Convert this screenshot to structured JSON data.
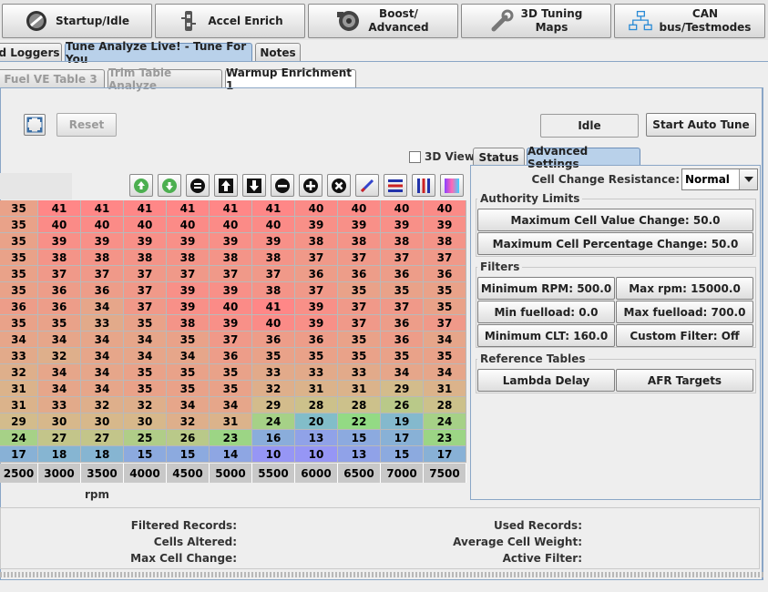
{
  "toolbar": {
    "startup": "Startup/Idle",
    "accel": "Accel Enrich",
    "boost_line1": "Boost/",
    "boost_line2": "Advanced",
    "tuning_line1": "3D Tuning",
    "tuning_line2": "Maps",
    "can_line1": "CAN",
    "can_line2": "bus/Testmodes"
  },
  "main_tabs": [
    "d Loggers",
    "Tune Analyze Live! - Tune For You",
    "Notes"
  ],
  "sub_tabs": [
    "Fuel VE Table 3",
    "Trim Table Analyze",
    "Warmup Enrichment 1"
  ],
  "controls": {
    "reset": "Reset",
    "status_value": "Idle",
    "start_auto_tune": "Start Auto Tune",
    "view_3d": "3D View"
  },
  "right_tabs": [
    "Status",
    "Advanced Settings"
  ],
  "settings": {
    "cell_change_resistance_label": "Cell Change Resistance:",
    "cell_change_resistance_value": "Normal",
    "authority_title": "Authority Limits",
    "max_cell_value_change": "Maximum Cell Value Change: 50.0",
    "max_cell_pct_change": "Maximum Cell Percentage Change: 50.0",
    "filters_title": "Filters",
    "min_rpm": "Minimum RPM: 500.0",
    "max_rpm": "Max rpm: 15000.0",
    "min_fuelload": "Min fuelload: 0.0",
    "max_fuelload": "Max fuelload: 700.0",
    "min_clt": "Minimum CLT: 160.0",
    "custom_filter": "Custom Filter: Off",
    "reference_title": "Reference Tables",
    "lambda_delay": "Lambda Delay",
    "afr_targets": "AFR Targets"
  },
  "table": {
    "x_axis": [
      "2500",
      "3000",
      "3500",
      "4000",
      "4500",
      "5000",
      "5500",
      "6000",
      "6500",
      "7000",
      "7500"
    ],
    "x_label": "rpm",
    "rows": [
      [
        "35",
        "41",
        "41",
        "41",
        "41",
        "41",
        "41",
        "40",
        "40",
        "40",
        "40"
      ],
      [
        "35",
        "40",
        "40",
        "40",
        "40",
        "40",
        "40",
        "39",
        "39",
        "39",
        "39"
      ],
      [
        "35",
        "39",
        "39",
        "39",
        "39",
        "39",
        "39",
        "38",
        "38",
        "38",
        "38"
      ],
      [
        "35",
        "38",
        "38",
        "38",
        "38",
        "38",
        "38",
        "37",
        "37",
        "37",
        "37"
      ],
      [
        "35",
        "37",
        "37",
        "37",
        "37",
        "37",
        "37",
        "36",
        "36",
        "36",
        "36"
      ],
      [
        "35",
        "36",
        "36",
        "37",
        "39",
        "39",
        "38",
        "37",
        "35",
        "35",
        "35"
      ],
      [
        "36",
        "36",
        "34",
        "37",
        "39",
        "40",
        "41",
        "39",
        "37",
        "37",
        "35"
      ],
      [
        "35",
        "35",
        "33",
        "35",
        "38",
        "39",
        "40",
        "39",
        "37",
        "36",
        "37"
      ],
      [
        "34",
        "34",
        "34",
        "34",
        "35",
        "37",
        "36",
        "36",
        "35",
        "36",
        "34"
      ],
      [
        "33",
        "32",
        "34",
        "34",
        "34",
        "36",
        "35",
        "35",
        "35",
        "35",
        "35"
      ],
      [
        "32",
        "34",
        "34",
        "35",
        "35",
        "35",
        "33",
        "33",
        "33",
        "34",
        "34"
      ],
      [
        "31",
        "34",
        "34",
        "35",
        "35",
        "35",
        "32",
        "31",
        "31",
        "29",
        "31"
      ],
      [
        "31",
        "33",
        "32",
        "32",
        "34",
        "34",
        "29",
        "28",
        "28",
        "26",
        "28"
      ],
      [
        "29",
        "30",
        "30",
        "30",
        "32",
        "31",
        "24",
        "20",
        "22",
        "19",
        "24"
      ],
      [
        "24",
        "27",
        "27",
        "25",
        "26",
        "23",
        "16",
        "13",
        "15",
        "17",
        "23"
      ],
      [
        "17",
        "18",
        "18",
        "15",
        "15",
        "14",
        "10",
        "10",
        "13",
        "15",
        "17"
      ]
    ]
  },
  "summary": {
    "filtered_records": "Filtered Records:",
    "cells_altered": "Cells Altered:",
    "max_cell_change": "Max Cell Change:",
    "used_records": "Used Records:",
    "average_cell_weight": "Average Cell Weight:",
    "active_filter": "Active Filter:"
  }
}
